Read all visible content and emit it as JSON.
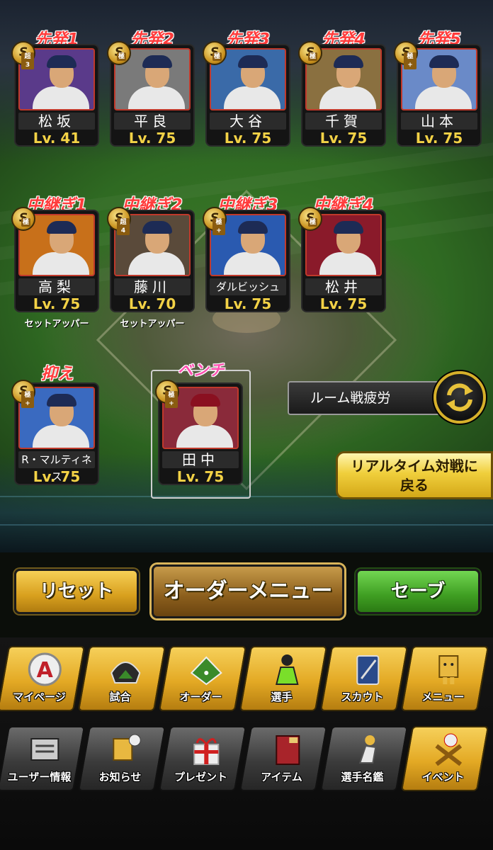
{
  "starters": [
    {
      "position": "先発1",
      "name": "松坂",
      "level": "Lv. 41",
      "rank": "S",
      "rank_sub": "超3",
      "photo_color": "#5a3a8a"
    },
    {
      "position": "先発2",
      "name": "平良",
      "level": "Lv. 75",
      "rank": "S",
      "rank_sub": "極",
      "photo_color": "#7a7a7a"
    },
    {
      "position": "先発3",
      "name": "大谷",
      "level": "Lv. 75",
      "rank": "S",
      "rank_sub": "極",
      "photo_color": "#3a6aa8"
    },
    {
      "position": "先発4",
      "name": "千賀",
      "level": "Lv. 75",
      "rank": "S",
      "rank_sub": "極",
      "photo_color": "#8a7040"
    },
    {
      "position": "先発5",
      "name": "山本",
      "level": "Lv. 75",
      "rank": "S",
      "rank_sub": "極+",
      "photo_color": "#6a8ac8"
    }
  ],
  "relievers": [
    {
      "position": "中継ぎ1",
      "name": "高梨",
      "level": "Lv. 75",
      "rank": "S",
      "rank_sub": "極",
      "role": "セットアッパー",
      "photo_color": "#c8701a"
    },
    {
      "position": "中継ぎ2",
      "name": "藤川",
      "level": "Lv. 70",
      "rank": "S",
      "rank_sub": "超4",
      "role": "セットアッパー",
      "photo_color": "#5a4a3a"
    },
    {
      "position": "中継ぎ3",
      "name": "ダルビッシュ",
      "level": "Lv. 75",
      "rank": "S",
      "rank_sub": "極+",
      "role": "",
      "photo_color": "#2a5ab0"
    },
    {
      "position": "中継ぎ4",
      "name": "松井",
      "level": "Lv. 75",
      "rank": "S",
      "rank_sub": "極",
      "role": "",
      "photo_color": "#8a1a2a"
    }
  ],
  "closer": {
    "position": "抑え",
    "name": "R・マルティネス",
    "level": "Lv. 75",
    "rank": "S",
    "rank_sub": "極+",
    "photo_color": "#3a6ac0"
  },
  "bench": {
    "position": "ベンチ",
    "name": "田中",
    "level": "Lv. 75",
    "rank": "S",
    "rank_sub": "極+",
    "photo_color": "#8a2a3a"
  },
  "room_fatigue_label": "ルーム戦疲労",
  "realtime_button": {
    "line1": "リアルタイム対戦に",
    "line2": "戻る"
  },
  "actions": {
    "reset": "リセット",
    "order_menu": "オーダーメニュー",
    "save": "セーブ"
  },
  "nav_primary": [
    {
      "label": "マイページ",
      "icon": "mypage-a-icon"
    },
    {
      "label": "試合",
      "icon": "stadium-icon"
    },
    {
      "label": "オーダー",
      "icon": "field-order-icon"
    },
    {
      "label": "選手",
      "icon": "player-icon"
    },
    {
      "label": "スカウト",
      "icon": "scout-icon"
    },
    {
      "label": "メニュー",
      "icon": "menu-box-icon"
    }
  ],
  "nav_secondary": [
    {
      "label": "ユーザー情報",
      "icon": "user-info-icon"
    },
    {
      "label": "お知らせ",
      "icon": "notice-icon"
    },
    {
      "label": "プレゼント",
      "icon": "present-icon"
    },
    {
      "label": "アイテム",
      "icon": "item-book-icon"
    },
    {
      "label": "選手名鑑",
      "icon": "player-directory-icon"
    },
    {
      "label": "イベント",
      "icon": "event-icon"
    }
  ],
  "colors": {
    "position_label": "#ff3b3b",
    "bench_label": "#ff4fb0",
    "level": "#f3d246",
    "save_button": "#3f9e22",
    "gold_button": "#e3a924"
  }
}
